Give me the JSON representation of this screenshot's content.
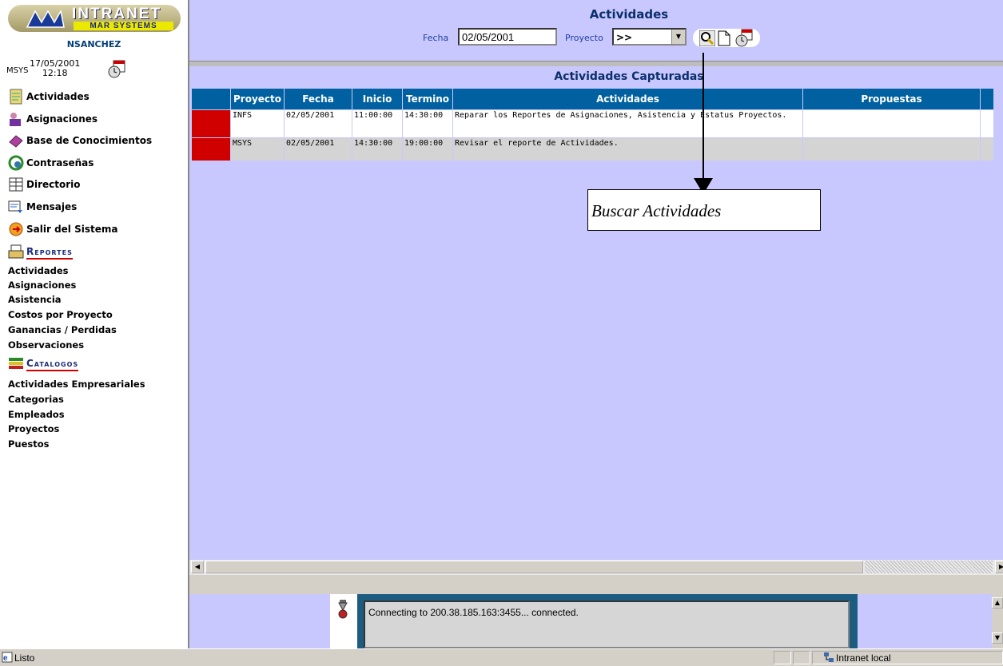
{
  "logo": {
    "title": "INTRANET",
    "subtitle": "MAR SYSTEMS"
  },
  "user": {
    "name": "NSANCHEZ",
    "org": "MSYS",
    "date": "17/05/2001",
    "time": "12:18"
  },
  "nav": [
    {
      "label": "Actividades",
      "icon": "activities-icon"
    },
    {
      "label": "Asignaciones",
      "icon": "assignments-icon"
    },
    {
      "label": "Base de Conocimientos",
      "icon": "book-icon"
    },
    {
      "label": "Contraseñas",
      "icon": "password-icon"
    },
    {
      "label": "Directorio",
      "icon": "directory-icon"
    },
    {
      "label": "Mensajes",
      "icon": "messages-icon"
    },
    {
      "label": "Salir del Sistema",
      "icon": "exit-icon"
    }
  ],
  "reportes": {
    "label": "Reportes",
    "items": [
      "Actividades",
      "Asignaciones",
      "Asistencia",
      "Costos por Proyecto",
      "Ganancias / Perdidas",
      "Observaciones"
    ]
  },
  "catalogos": {
    "label": "Catalogos",
    "items": [
      "Actividades Empresariales",
      "Categorias",
      "Empleados",
      "Proyectos",
      "Puestos"
    ]
  },
  "header": {
    "title": "Actividades",
    "fecha_label": "Fecha",
    "fecha_value": "02/05/2001",
    "proyecto_label": "Proyecto",
    "proyecto_value": ">>"
  },
  "table": {
    "title": "Actividades Capturadas",
    "columns": [
      "Proyecto",
      "Fecha",
      "Inicio",
      "Termino",
      "Actividades",
      "Propuestas"
    ],
    "rows": [
      {
        "proyecto": "INFS",
        "fecha": "02/05/2001",
        "inicio": "11:00:00",
        "termino": "14:30:00",
        "actividades": "Reparar los Reportes de Asignaciones, Asistencia y Estatus Proyectos.",
        "propuestas": ""
      },
      {
        "proyecto": "MSYS",
        "fecha": "02/05/2001",
        "inicio": "14:30:00",
        "termino": "19:00:00",
        "actividades": "Revisar el reporte de Actividades.",
        "propuestas": ""
      }
    ],
    "status_color": "#d00000"
  },
  "callout": {
    "text": "Buscar Actividades"
  },
  "connection": {
    "message": "Connecting to 200.38.185.163:3455... connected."
  },
  "statusbar": {
    "text": "Listo",
    "zone": "Intranet local"
  }
}
